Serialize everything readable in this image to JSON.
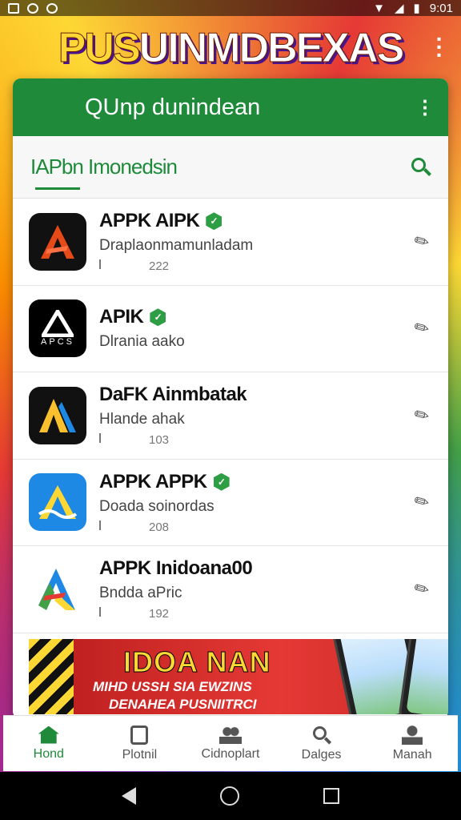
{
  "status_bar": {
    "time": "9:01"
  },
  "banner": {
    "title_yellow": "PUS",
    "title_white": "UINMDBEXAS"
  },
  "card": {
    "header_title": "QUnp dunindean",
    "search_label": "IAPbn Imonedsin"
  },
  "apps": [
    {
      "name": "APPK AIPK",
      "desc": "Draplaonmamunladam",
      "meta": "222",
      "verified": true,
      "icon_colors": [
        "#111111",
        "#e64a19"
      ]
    },
    {
      "name": "APIK",
      "desc": "Dlrania aako",
      "meta": "",
      "verified": true,
      "icon_colors": [
        "#000000",
        "#ffffff"
      ],
      "icon_text": "APCS"
    },
    {
      "name": "DaFK Ainmbatak",
      "desc": "Hlande ahak",
      "meta": "103",
      "verified": false,
      "icon_colors": [
        "#111111",
        "#fbc02d"
      ]
    },
    {
      "name": "APPK APPK",
      "desc": "Doada soinordas",
      "meta": "208",
      "verified": true,
      "icon_colors": [
        "#1e88e5",
        "#fdd835"
      ]
    },
    {
      "name": "APPK Inidoana00",
      "desc": "Bndda aPric",
      "meta": "192",
      "verified": false,
      "icon_colors": [
        "#ffffff",
        "#e53935"
      ]
    }
  ],
  "promo": {
    "headline": "IDOA NAN",
    "line1": "MIHD USSH SIA EWZINS",
    "line2": "DENAHEA PUSNIITRCI"
  },
  "bottom_nav": [
    {
      "label": "Hond",
      "icon": "home-icon",
      "active": true
    },
    {
      "label": "Plotnil",
      "icon": "box-icon",
      "active": false
    },
    {
      "label": "Cidnoplart",
      "icon": "people-icon",
      "active": false
    },
    {
      "label": "Dalges",
      "icon": "search-icon",
      "active": false
    },
    {
      "label": "Manah",
      "icon": "person-icon",
      "active": false
    }
  ],
  "colors": {
    "primary_green": "#1e8a3a",
    "badge_green": "#2e9e44",
    "promo_red": "#e53935"
  }
}
